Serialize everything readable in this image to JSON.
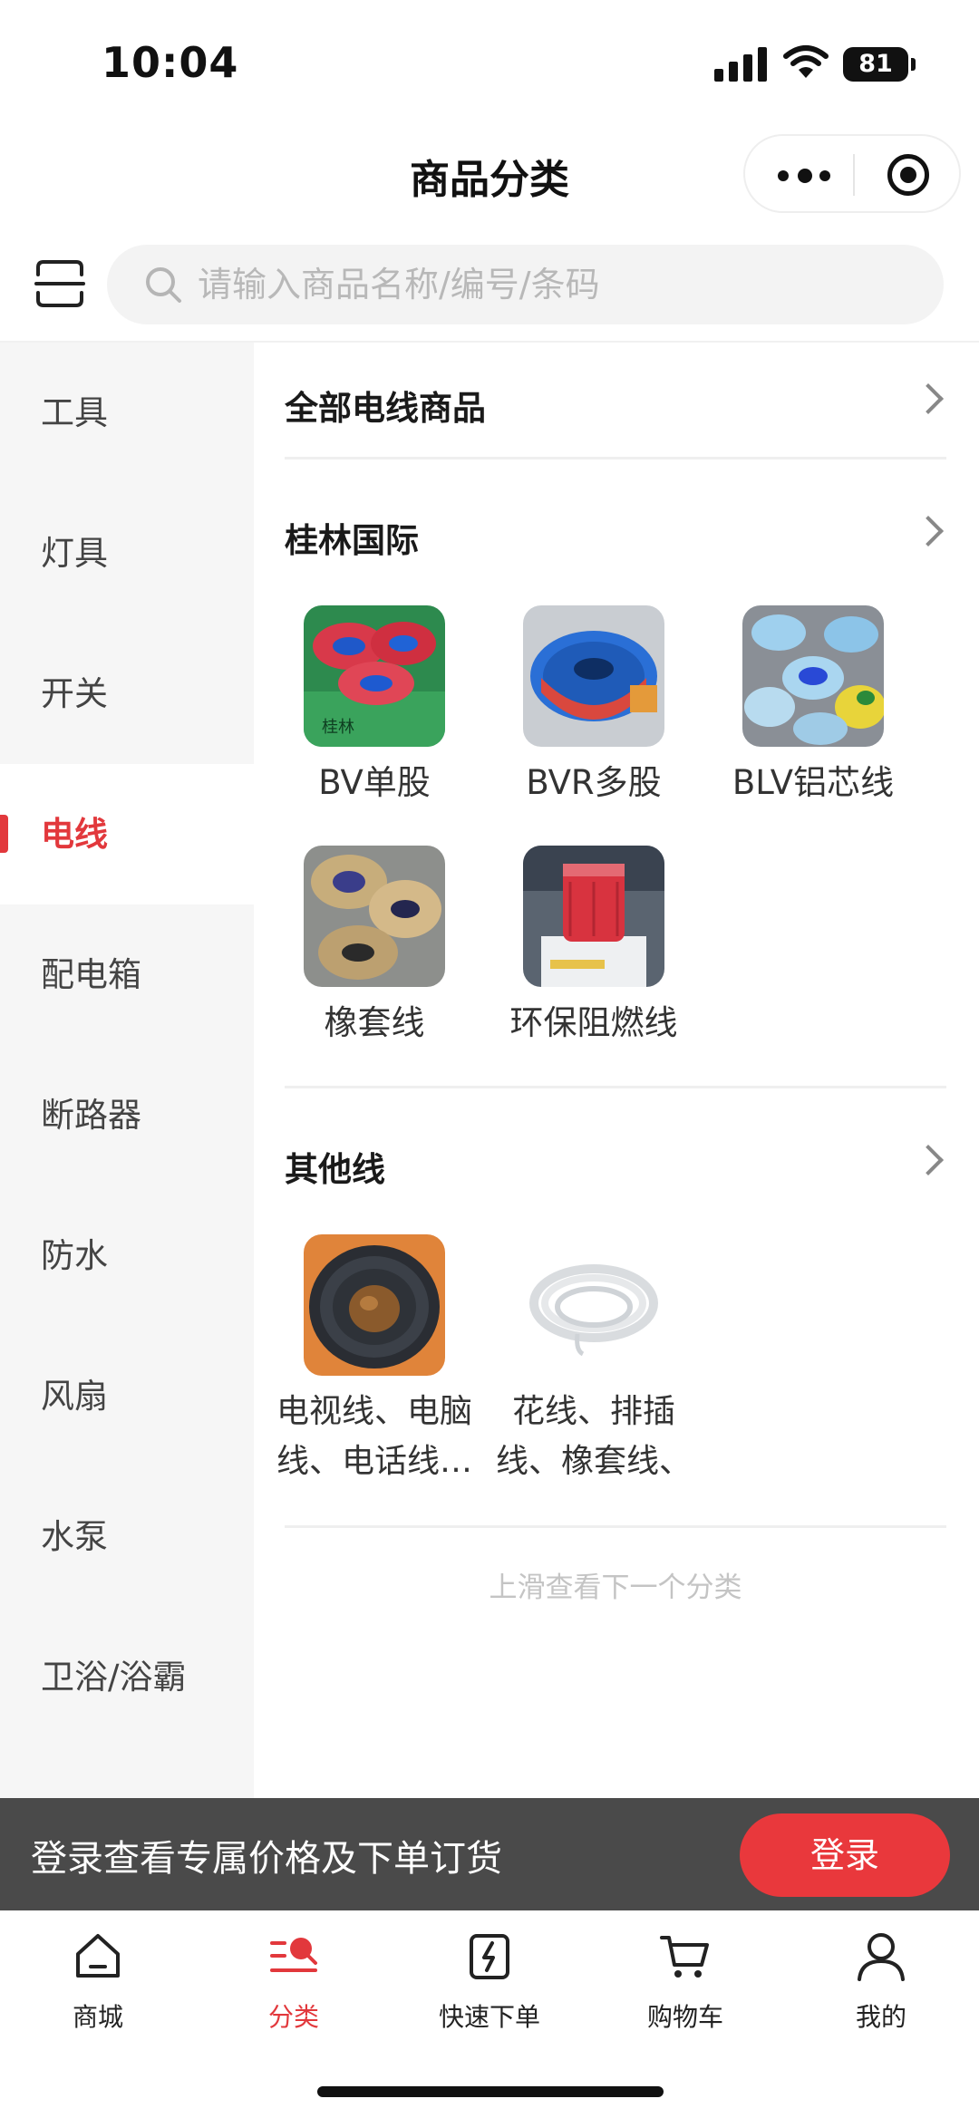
{
  "status_bar": {
    "time": "10:04",
    "battery": "81"
  },
  "header": {
    "title": "商品分类"
  },
  "search": {
    "placeholder": "请输入商品名称/编号/条码"
  },
  "sidebar": {
    "items": [
      {
        "label": "工具"
      },
      {
        "label": "灯具"
      },
      {
        "label": "开关"
      },
      {
        "label": "电线",
        "active": true
      },
      {
        "label": "配电箱"
      },
      {
        "label": "断路器"
      },
      {
        "label": "防水"
      },
      {
        "label": "风扇"
      },
      {
        "label": "水泵"
      },
      {
        "label": "卫浴/浴霸"
      }
    ]
  },
  "main": {
    "all_link": "全部电线商品",
    "sections": [
      {
        "title": "桂林国际",
        "products": [
          {
            "name": "BV单股"
          },
          {
            "name": "BVR多股"
          },
          {
            "name": "BLV铝芯线"
          },
          {
            "name": "橡套线"
          },
          {
            "name": "环保阻燃线"
          }
        ]
      },
      {
        "title": "其他线",
        "products": [
          {
            "name": "电视线、电脑线、电话线…"
          },
          {
            "name": "花线、排插线、橡套线、"
          }
        ]
      }
    ],
    "hint": "上滑查看下一个分类"
  },
  "login_bar": {
    "text": "登录查看专属价格及下单订货",
    "button": "登录"
  },
  "tabbar": {
    "items": [
      {
        "label": "商城",
        "icon": "home-icon"
      },
      {
        "label": "分类",
        "icon": "category-icon",
        "active": true
      },
      {
        "label": "快速下单",
        "icon": "quick-order-icon"
      },
      {
        "label": "购物车",
        "icon": "cart-icon"
      },
      {
        "label": "我的",
        "icon": "user-icon"
      }
    ]
  },
  "colors": {
    "accent": "#e2383c",
    "login_bar": "#4a4a4a"
  }
}
